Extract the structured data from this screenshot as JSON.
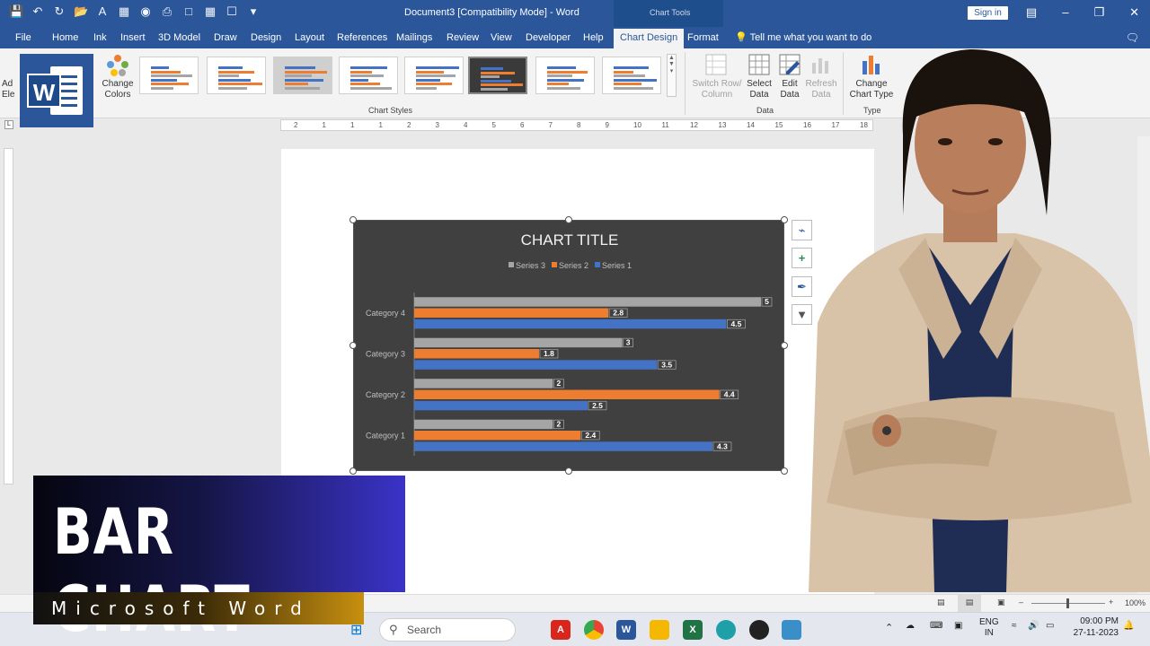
{
  "window": {
    "title": "Document3 [Compatibility Mode]  -  Word",
    "context_group": "Chart Tools",
    "signin_label": "Sign in"
  },
  "tabs": [
    "File",
    "Home",
    "Ink",
    "Insert",
    "3D Model",
    "Draw",
    "Design",
    "Layout",
    "References",
    "Mailings",
    "Review",
    "View",
    "Developer",
    "Help",
    "Chart Design",
    "Format"
  ],
  "active_tab": "Chart Design",
  "tell_me": "Tell me what you want to do",
  "ribbon": {
    "add_element_label": "Ad\nEle",
    "change_colors_label": "Change\nColors",
    "chart_styles_group": "Chart Styles",
    "data_group": "Data",
    "type_group": "Type",
    "switch_row_col": "Switch Row/\nColumn",
    "select_data": "Select\nData",
    "edit_data": "Edit\nData",
    "refresh_data": "Refresh\nData",
    "change_chart_type": "Change\nChart Type"
  },
  "ruler_numbers": [
    "2",
    "1",
    "1",
    "1",
    "2",
    "3",
    "4",
    "5",
    "6",
    "7",
    "8",
    "9",
    "10",
    "11",
    "12",
    "13",
    "14",
    "15",
    "16",
    "17",
    "18"
  ],
  "chart_data": {
    "type": "bar",
    "orientation": "horizontal",
    "title": "CHART TITLE",
    "categories": [
      "Category 1",
      "Category 2",
      "Category 3",
      "Category 4"
    ],
    "series": [
      {
        "name": "Series 1",
        "color": "#4472c4",
        "values": [
          4.3,
          2.5,
          3.5,
          4.5
        ]
      },
      {
        "name": "Series 2",
        "color": "#ed7d31",
        "values": [
          2.4,
          4.4,
          1.8,
          2.8
        ]
      },
      {
        "name": "Series 3",
        "color": "#a5a5a5",
        "values": [
          2,
          2,
          3,
          5
        ]
      }
    ],
    "legend_order": [
      "Series 3",
      "Series 2",
      "Series 1"
    ],
    "legend_position": "top",
    "xlim": [
      0,
      5
    ],
    "data_labels": true,
    "background": "#404040"
  },
  "statusbar": {
    "zoom": "100%"
  },
  "taskbar": {
    "search_placeholder": "Search",
    "language": "ENG\nIN",
    "time": "09:00 PM",
    "date": "27-11-2023"
  },
  "overlay": {
    "headline": "BAR CHART",
    "subline": "Microsoft Word"
  },
  "colors": {
    "word_blue": "#2b579a",
    "banner_blue": "#3a33c8",
    "banner_gold": "#c8900f"
  }
}
